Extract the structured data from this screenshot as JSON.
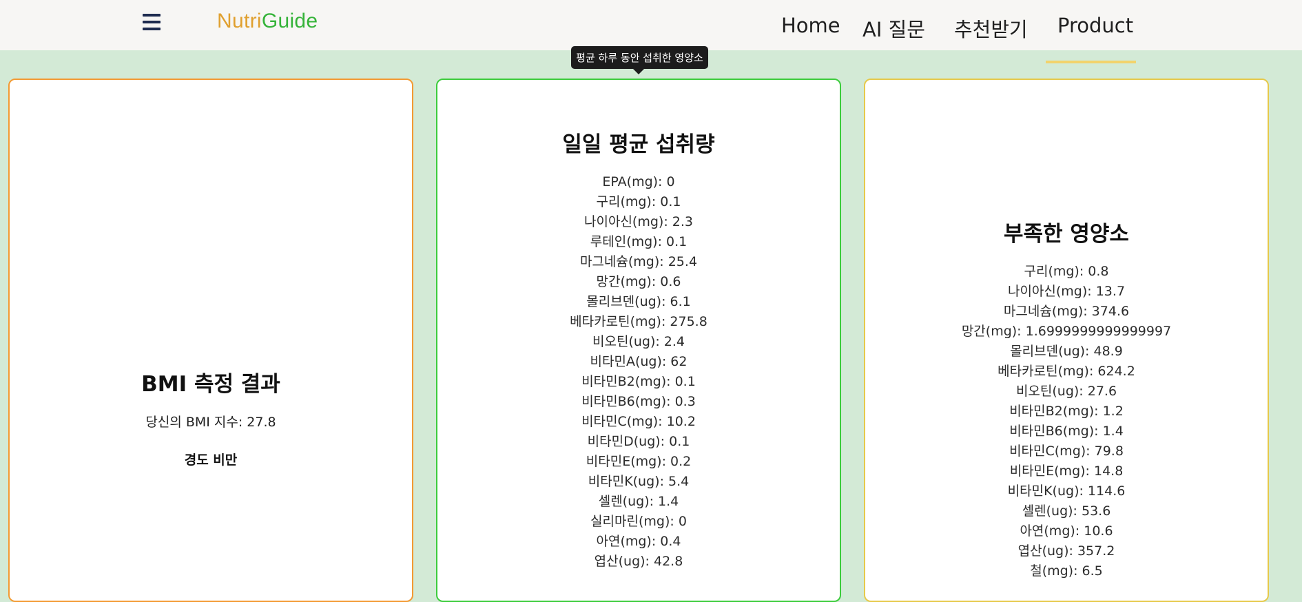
{
  "navbar": {
    "brand_part1": "Nutri",
    "brand_part2": "Guide",
    "links": [
      {
        "label": "Home"
      },
      {
        "label": "AI 질문"
      },
      {
        "label": "추천받기"
      },
      {
        "label": "Product"
      }
    ],
    "active": "Product"
  },
  "tooltip": {
    "text": "평균 하루 동안 섭취한 영양소"
  },
  "bmi_card": {
    "title": "BMI 측정 결과",
    "value_text": "당신의 BMI 지수: 27.8",
    "status": "경도 비만"
  },
  "daily_card": {
    "title": "일일 평균 섭취량",
    "items": [
      "EPA(mg): 0",
      "구리(mg): 0.1",
      "나이아신(mg): 2.3",
      "루테인(mg): 0.1",
      "마그네슘(mg): 25.4",
      "망간(mg): 0.6",
      "몰리브덴(ug): 6.1",
      "베타카로틴(mg): 275.8",
      "비오틴(ug): 2.4",
      "비타민A(ug): 62",
      "비타민B2(mg): 0.1",
      "비타민B6(mg): 0.3",
      "비타민C(mg): 10.2",
      "비타민D(ug): 0.1",
      "비타민E(mg): 0.2",
      "비타민K(ug): 5.4",
      "셀렌(ug): 1.4",
      "실리마린(mg): 0",
      "아연(mg): 0.4",
      "엽산(ug): 42.8"
    ]
  },
  "lack_card": {
    "title": "부족한 영양소",
    "items": [
      "구리(mg): 0.8",
      "나이아신(mg): 13.7",
      "마그네슘(mg): 374.6",
      "망간(mg): 1.6999999999999997",
      "몰리브덴(ug): 48.9",
      "베타카로틴(mg): 624.2",
      "비오틴(ug): 27.6",
      "비타민B2(mg): 1.2",
      "비타민B6(mg): 1.4",
      "비타민C(mg): 79.8",
      "비타민E(mg): 14.8",
      "비타민K(ug): 114.6",
      "셀렌(ug): 53.6",
      "아연(mg): 10.6",
      "엽산(ug): 357.2",
      "철(mg): 6.5"
    ]
  },
  "colors": {
    "background": "#d3ead6",
    "brand_nutri": "#e0a02f",
    "brand_guide": "#35b339",
    "bmi_border": "#f39a33",
    "daily_border": "#3ccc3c",
    "lack_border": "#e6c94a",
    "active_underline": "#f2d36c"
  }
}
